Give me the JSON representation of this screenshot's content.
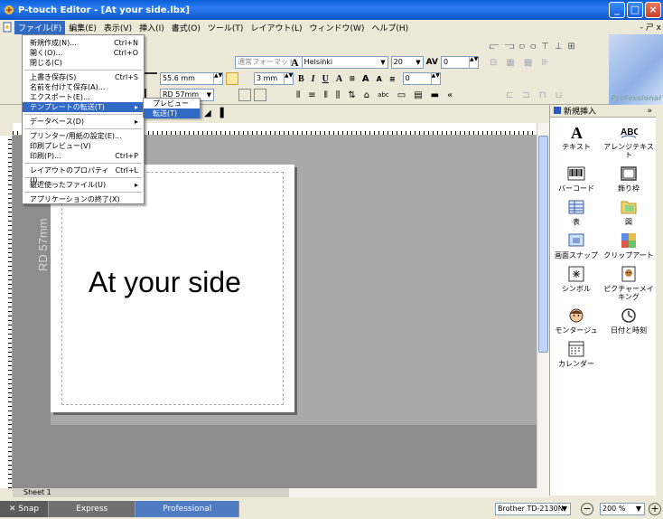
{
  "window": {
    "title": "P-touch Editor - [At your side.lbx]",
    "buttons": [
      "_",
      "□",
      "×"
    ]
  },
  "menubar": {
    "items": [
      "ファイル(F)",
      "編集(E)",
      "表示(V)",
      "挿入(I)",
      "書式(O)",
      "ツール(T)",
      "レイアウト(L)",
      "ウィンドウ(W)",
      "ヘルプ(H)"
    ],
    "mdi_buttons": "- ㄕ x"
  },
  "file_menu": {
    "items": [
      {
        "label": "新規作成(N)...",
        "shortcut": "Ctrl+N"
      },
      {
        "label": "開く(O)...",
        "shortcut": "Ctrl+O"
      },
      {
        "label": "閉じる(C)",
        "shortcut": ""
      },
      {
        "label": "上書き保存(S)",
        "shortcut": "Ctrl+S"
      },
      {
        "label": "名前を付けて保存(A)...",
        "shortcut": ""
      },
      {
        "label": "エクスポート(E)...",
        "shortcut": ""
      },
      {
        "label": "テンプレートの転送(T)",
        "shortcut": "▸"
      },
      {
        "label": "データベース(D)",
        "shortcut": "▸"
      },
      {
        "label": "プリンター/用紙の設定(E)...",
        "shortcut": ""
      },
      {
        "label": "印刷プレビュー(V)",
        "shortcut": ""
      },
      {
        "label": "印刷(P)...",
        "shortcut": "Ctrl+P"
      },
      {
        "label": "レイアウトのプロパティ(I)...",
        "shortcut": "Ctrl+L"
      },
      {
        "label": "最近使ったファイル(U)",
        "shortcut": "▸"
      },
      {
        "label": "アプリケーションの終了(X)",
        "shortcut": ""
      }
    ]
  },
  "submenu": {
    "items": [
      "プレビュー(V)",
      "転送(T)"
    ]
  },
  "toolbar": {
    "style_field": "通常フォーマット",
    "width_field": "55.6 mm",
    "length_field": "3 mm",
    "tape_field": "RD 57mm",
    "font_field": "Helsinki",
    "size_field": "20",
    "spacing_field": "0",
    "line_field": "0",
    "brand_text": "Professional"
  },
  "side_panel": {
    "header": "新規挿入",
    "collapse": "»",
    "tools": [
      {
        "label": "テキスト",
        "icon": "text-icon"
      },
      {
        "label": "アレンジテキスト",
        "icon": "arrange-text-icon"
      },
      {
        "label": "バーコード",
        "icon": "barcode-icon"
      },
      {
        "label": "飾り枠",
        "icon": "frame-icon"
      },
      {
        "label": "表",
        "icon": "table-icon"
      },
      {
        "label": "図",
        "icon": "image-icon"
      },
      {
        "label": "画面スナップ",
        "icon": "screen-snap-icon"
      },
      {
        "label": "クリップアート",
        "icon": "clipart-icon"
      },
      {
        "label": "シンボル",
        "icon": "symbol-icon"
      },
      {
        "label": "ピクチャーメイキング",
        "icon": "picture-making-icon"
      },
      {
        "label": "モンタージュ",
        "icon": "montage-icon"
      },
      {
        "label": "日付と時刻",
        "icon": "clock-icon"
      },
      {
        "label": "カレンダー",
        "icon": "calendar-icon"
      }
    ]
  },
  "canvas": {
    "label_text": "At your side",
    "tape_tag": "RD 57mm",
    "sheet_tab": "Sheet 1"
  },
  "statusbar": {
    "snap": "Snap",
    "modes": [
      "Express",
      "Professional"
    ],
    "printer": "Brother TD-2130N",
    "zoom": "200 %"
  },
  "colors": {
    "title_blue": "#0a5fd8",
    "highlight": "#316ac5",
    "workspace": "#a9a9a9"
  }
}
